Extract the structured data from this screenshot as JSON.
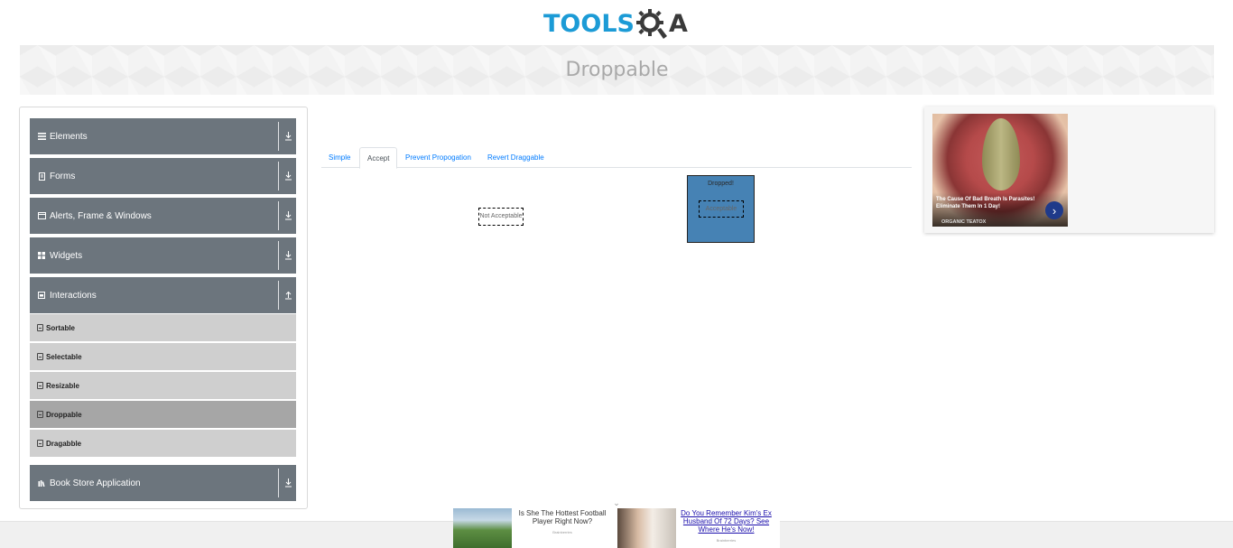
{
  "logo": {
    "text_left": "TOOLS",
    "text_right": "A"
  },
  "page_title": "Droppable",
  "sidebar": {
    "groups": [
      {
        "label": "Elements"
      },
      {
        "label": "Forms"
      },
      {
        "label": "Alerts, Frame & Windows"
      },
      {
        "label": "Widgets"
      },
      {
        "label": "Interactions"
      },
      {
        "label": "Book Store Application"
      }
    ],
    "items": [
      {
        "label": "Sortable"
      },
      {
        "label": "Selectable"
      },
      {
        "label": "Resizable"
      },
      {
        "label": "Droppable"
      },
      {
        "label": "Dragabble"
      }
    ],
    "active_item": "Droppable"
  },
  "tabs": [
    {
      "label": "Simple"
    },
    {
      "label": "Accept"
    },
    {
      "label": "Prevent Propogation"
    },
    {
      "label": "Revert Draggable"
    }
  ],
  "active_tab": "Accept",
  "draggables": {
    "not_acceptable": "Not Acceptable",
    "acceptable": "Acceptable"
  },
  "drop_target": {
    "text": "Dropped!",
    "color": "#4682b4"
  },
  "ad_right": {
    "headline": "The Cause Of Bad Breath Is Parasites! Eliminate Them In 1 Day!",
    "sponsor": "ORGANIC TEATOX"
  },
  "bottom_ads": [
    {
      "text": "Is She The Hottest Football Player Right Now?",
      "source": "Brainberries"
    },
    {
      "text": "Do You Remember Kim's Ex Husband Of 72 Days? See Where He's Now!",
      "source": "Brainberries"
    }
  ],
  "colors": {
    "accent": "#1c9bd6",
    "sidebar_group": "#6c757d",
    "link": "#007bff"
  }
}
